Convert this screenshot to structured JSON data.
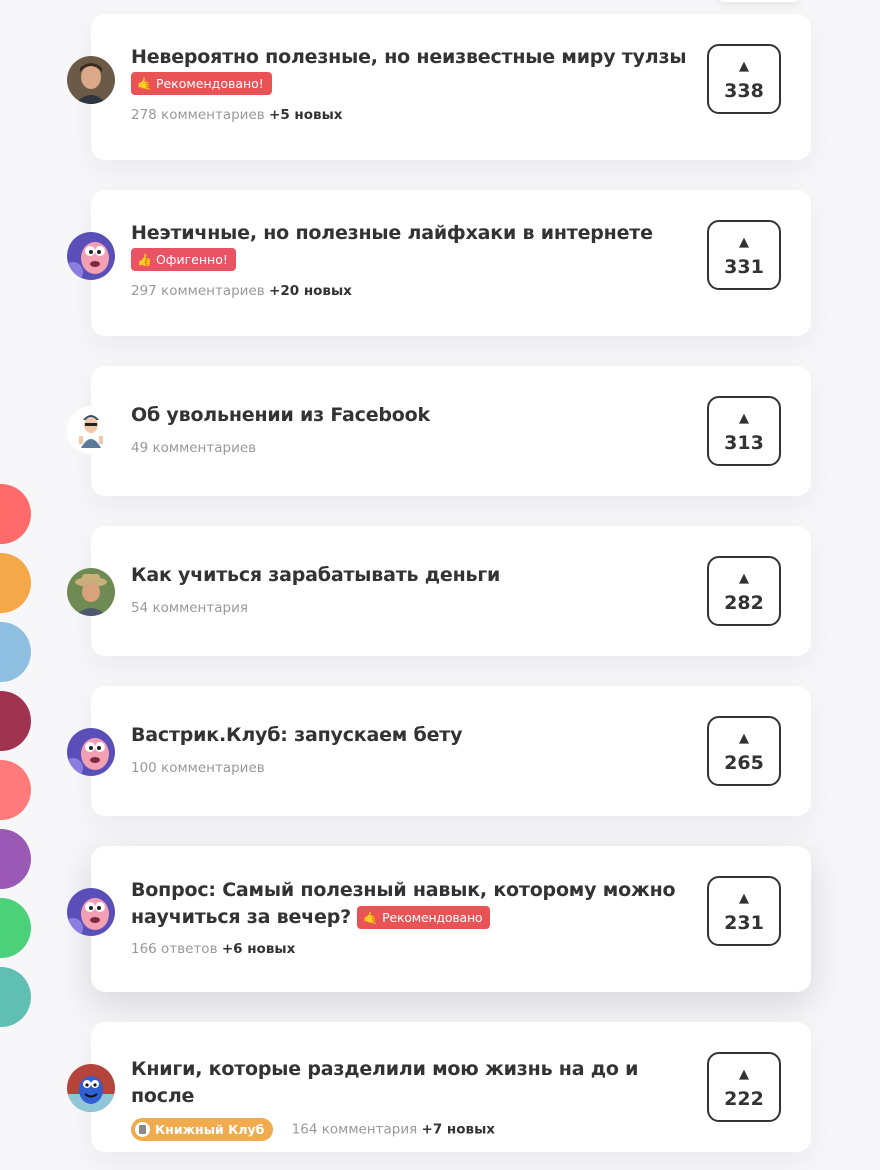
{
  "posts": [
    {
      "title": "Невероятно полезные, но неизвестные миру тулзы",
      "badge": {
        "icon": "hand-emoji-icon",
        "glyph": "🤙",
        "label": "Рекомендовано!",
        "color": "#ea5356"
      },
      "comments": "278 комментариев",
      "new": "+5 новых",
      "votes": "338",
      "avatar": "avatar-man-portrait"
    },
    {
      "title": "Неэтичные, но полезные лайфхаки в интернете",
      "badge": {
        "icon": "thumbs-up-icon",
        "glyph": "👍",
        "label": "Офигенно!",
        "color": "#e95364"
      },
      "comments": "297 комментариев",
      "new": "+20 новых",
      "votes": "331",
      "avatar": "avatar-pink-worm"
    },
    {
      "title": "Об увольнении из Facebook",
      "comments": "49 комментариев",
      "votes": "313",
      "avatar": "avatar-cartoon-man"
    },
    {
      "title": "Как учиться зарабатывать деньги",
      "comments": "54 комментария",
      "votes": "282",
      "avatar": "avatar-man-hat"
    },
    {
      "title": "Вастрик.Клуб: запускаем бету",
      "comments": "100 комментариев",
      "votes": "265",
      "avatar": "avatar-pink-worm"
    },
    {
      "title_line1": "Вопрос: Самый полезный навык, которому можно",
      "title_line2": "научиться за вечер?",
      "badge": {
        "icon": "hand-emoji-icon",
        "glyph": "🤙",
        "label": "Рекомендовано",
        "color": "#ea5356"
      },
      "comments": "166 ответов",
      "new": "+6 новых",
      "votes": "231",
      "avatar": "avatar-pink-worm"
    },
    {
      "title": "Книги, которые разделили мою жизнь на до и после",
      "badge": {
        "icon": "book-club-icon",
        "label": "Книжный Клуб",
        "color": "#f0ab4e"
      },
      "comments": "164 комментария",
      "new": "+7 новых",
      "votes": "222",
      "avatar": "avatar-blue-creature"
    }
  ],
  "upvote_arrow": "▲",
  "side_dots": [
    {
      "color": "#ff6b6b"
    },
    {
      "color": "#f4a84a"
    },
    {
      "color": "#8fbfe0"
    },
    {
      "color": "#a0334f"
    },
    {
      "color": "#ff7b7b"
    },
    {
      "color": "#9b59b6"
    },
    {
      "color": "#4cd17a"
    },
    {
      "color": "#5fbfb3"
    }
  ]
}
